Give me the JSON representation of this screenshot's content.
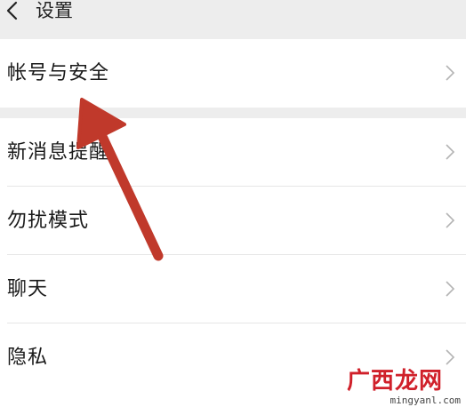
{
  "header": {
    "title": "设置"
  },
  "groups": [
    {
      "items": [
        {
          "label": "帐号与安全"
        }
      ]
    },
    {
      "items": [
        {
          "label": "新消息提醒"
        },
        {
          "label": "勿扰模式"
        },
        {
          "label": "聊天"
        },
        {
          "label": "隐私"
        }
      ]
    }
  ],
  "watermark": {
    "logo": "广西龙网",
    "url": "mingyanl.com"
  },
  "colors": {
    "background": "#ededed",
    "row_background": "#ffffff",
    "annotation_arrow": "#c0392b"
  }
}
